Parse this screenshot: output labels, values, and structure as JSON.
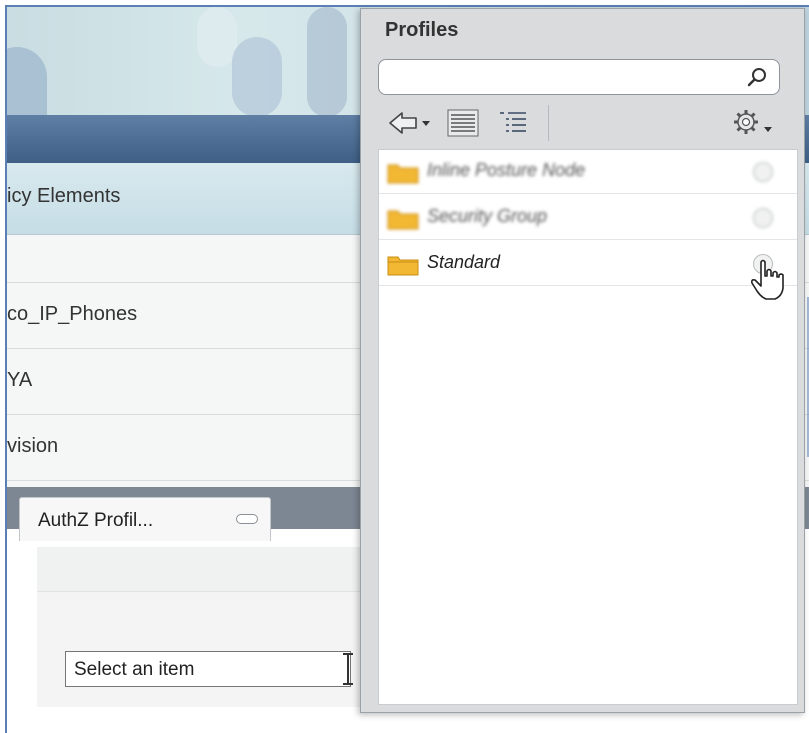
{
  "background_page": {
    "subnav_label": "icy Elements",
    "rows": [
      "co_IP_Phones",
      "YA",
      "vision"
    ],
    "tab_label": "AuthZ Profil...",
    "select_value": "Select an item"
  },
  "popup": {
    "title": "Profiles",
    "search_placeholder": "",
    "toolbar": {
      "back_icon": "back-arrow-icon",
      "list_view_icon": "list-view-icon",
      "tree_view_icon": "tree-view-icon",
      "settings_icon": "gear-icon"
    },
    "items": [
      {
        "label": "Inline Posture Node",
        "blurred": true
      },
      {
        "label": "Security Group",
        "blurred": true
      },
      {
        "label": "Standard",
        "blurred": false
      }
    ]
  },
  "colors": {
    "navbar": "#4d6e95",
    "folder": "#f2b733",
    "frame_border": "#5b7fb4"
  }
}
